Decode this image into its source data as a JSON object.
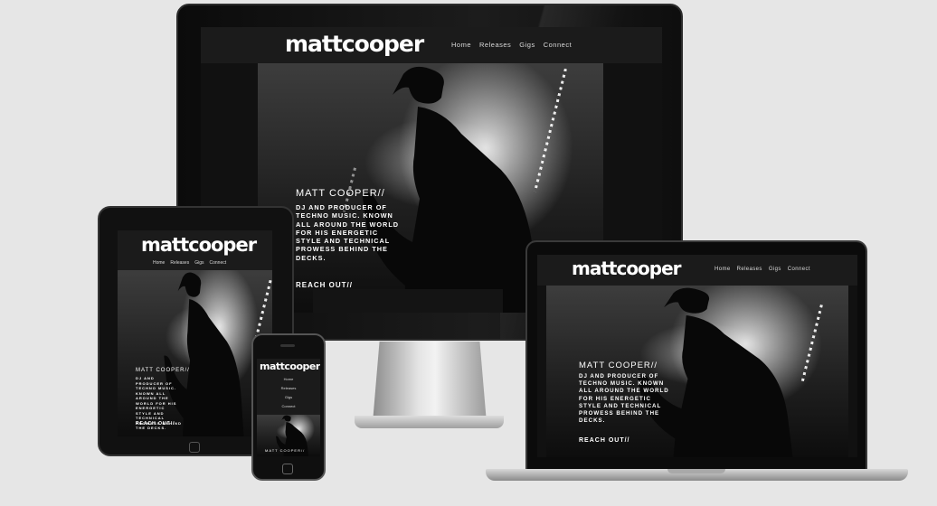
{
  "site": {
    "logo": "mattcooper",
    "nav": [
      "Home",
      "Releases",
      "Gigs",
      "Connect"
    ],
    "hero_title": "MATT COOPER//",
    "hero_text": "DJ AND PRODUCER OF TECHNO MUSIC. KNOWN ALL AROUND THE WORLD FOR HIS ENERGETIC STYLE AND TECHNICAL PROWESS BEHIND THE DECKS.",
    "cta": "REACH OUT//"
  },
  "devices": [
    "desktop-monitor",
    "tablet",
    "phone",
    "laptop"
  ],
  "colors": {
    "page_background": "#e6e6e6",
    "site_background": "#111111",
    "text": "#ffffff"
  }
}
